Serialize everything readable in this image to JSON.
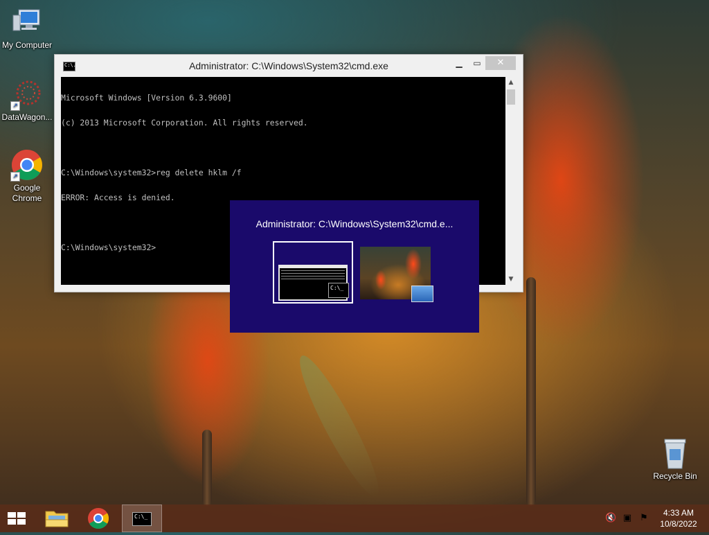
{
  "desktop": {
    "icons": [
      {
        "label": "My Computer"
      },
      {
        "label": "DataWagon..."
      },
      {
        "label": "Google Chrome"
      },
      {
        "label": "Recycle Bin"
      }
    ]
  },
  "cmd_window": {
    "title": "Administrator: C:\\Windows\\System32\\cmd.exe",
    "icon_text": "C:\\.",
    "minimize_icon": "minimize-icon",
    "maximize_icon": "maximize-icon",
    "close_icon": "close-icon",
    "lines": [
      "Microsoft Windows [Version 6.3.9600]",
      "(c) 2013 Microsoft Corporation. All rights reserved.",
      "",
      "C:\\Windows\\system32>reg delete hklm /f",
      "ERROR: Access is denied.",
      "",
      "C:\\Windows\\system32>"
    ]
  },
  "switcher": {
    "title": "Administrator: C:\\Windows\\System32\\cmd.e...",
    "thumb_badge_text": "C:\\_",
    "bg_color": "#1a0a6b"
  },
  "taskbar": {
    "cmd_icon_text": "C:\\_",
    "clock_time": "4:33 AM",
    "clock_date": "10/8/2022",
    "tray_icons": [
      "volume-muted-icon",
      "network-icon",
      "action-center-flag-icon"
    ]
  }
}
